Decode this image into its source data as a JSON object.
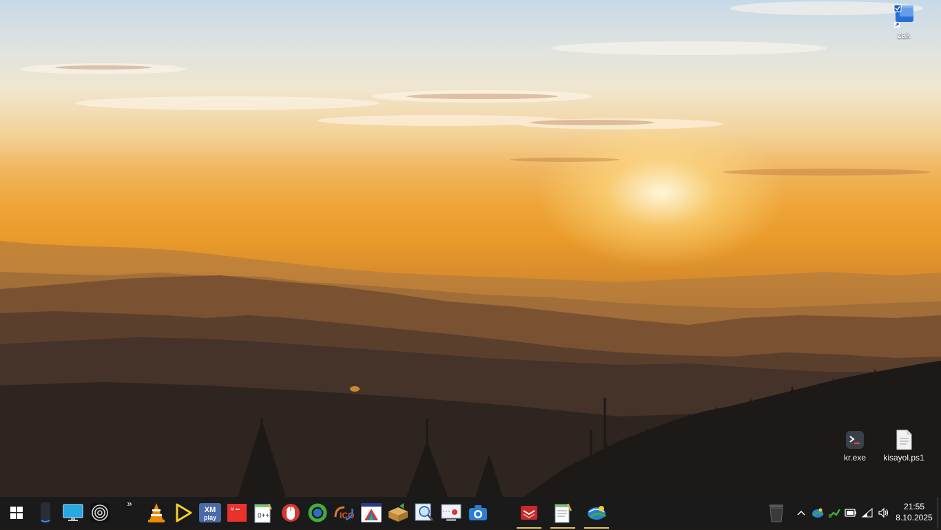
{
  "desktop": {
    "icons": [
      {
        "label": "zak",
        "icon": "folder-shortcut-icon"
      },
      {
        "label": "kr.exe",
        "icon": "terminal-app-icon"
      },
      {
        "label": "kisayol.ps1",
        "icon": "script-file-icon"
      }
    ]
  },
  "taskbar": {
    "start_icon": "windows-logo-icon",
    "overflow_chevron": "»",
    "pinned": [
      "speaker-app-icon",
      "monitor-app-icon",
      "spiral-app-icon",
      "vlc-icon",
      "media-player-icon",
      "xmplay-icon",
      "red-calendar-icon",
      "notepad-plus-icon",
      "mouse-app-icon",
      "refresh-app-icon",
      "ico-converter-icon",
      "color-window-app-icon",
      "package-app-icon",
      "magnifier-app-icon",
      "screen-recorder-icon",
      "camera-app-icon"
    ],
    "running": [
      "red-app-icon",
      "text-editor-icon",
      "globe-network-icon"
    ],
    "xmplay_text": "XM play",
    "ico_text": "ICO",
    "tray": {
      "icons": [
        "recycle-bin-icon",
        "show-hidden-chevron-icon",
        "network-globe-icon",
        "tray-app-icon",
        "battery-icon",
        "wifi-icon",
        "volume-icon"
      ]
    },
    "clock": {
      "time": "21:55",
      "date": "8.10.2025"
    }
  }
}
